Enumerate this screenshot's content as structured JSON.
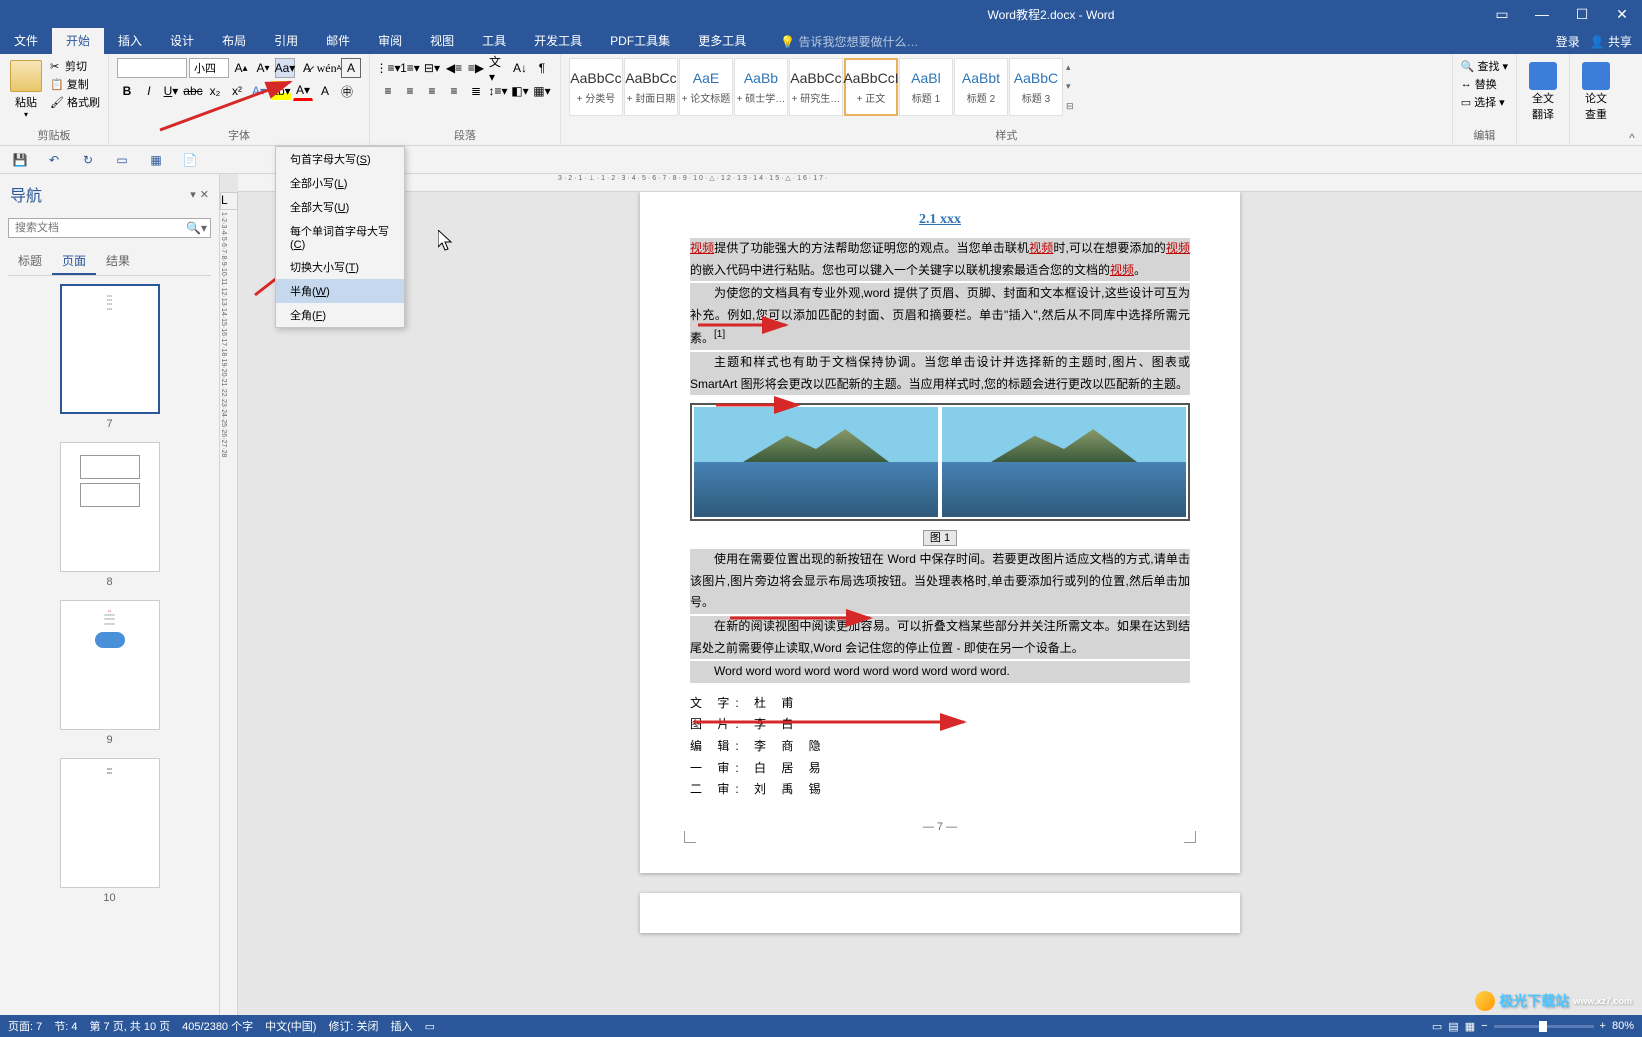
{
  "title": "Word教程2.docx - Word",
  "title_controls": {
    "login": "登录",
    "share": "共享"
  },
  "tabs": {
    "file": "文件",
    "home": "开始",
    "insert": "插入",
    "design": "设计",
    "layout": "布局",
    "references": "引用",
    "mailings": "邮件",
    "review": "审阅",
    "view": "视图",
    "tools": "工具",
    "developer": "开发工具",
    "pdf": "PDF工具集",
    "more": "更多工具",
    "tellme": "告诉我您想要做什么…"
  },
  "clipboard": {
    "paste": "粘贴",
    "cut": "剪切",
    "copy": "复制",
    "format_painter": "格式刷",
    "label": "剪贴板"
  },
  "font": {
    "name": "",
    "size": "小四",
    "label": "字体"
  },
  "paragraph": {
    "label": "段落"
  },
  "styles": {
    "label": "样式",
    "items": [
      {
        "preview": "AaBbCc",
        "name": "+ 分类号"
      },
      {
        "preview": "AaBbCc",
        "name": "+ 封面日期"
      },
      {
        "preview": "AaE",
        "name": "+ 论文标题"
      },
      {
        "preview": "AaBb",
        "name": "+ 硕士学…"
      },
      {
        "preview": "AaBbCc",
        "name": "+ 研究生…"
      },
      {
        "preview": "AaBbCcI",
        "name": "+ 正文"
      },
      {
        "preview": "AaBl",
        "name": "标题 1"
      },
      {
        "preview": "AaBbt",
        "name": "标题 2"
      },
      {
        "preview": "AaBbC",
        "name": "标题 3"
      }
    ],
    "selected": 5
  },
  "editing": {
    "find": "查找",
    "replace": "替换",
    "select": "选择",
    "label": "编辑"
  },
  "translate": {
    "label": "全文",
    "label2": "翻译"
  },
  "review": {
    "label": "论文",
    "label2": "查重"
  },
  "change_case_menu": [
    {
      "text": "句首字母大写",
      "key": "S"
    },
    {
      "text": "全部小写",
      "key": "L"
    },
    {
      "text": "全部大写",
      "key": "U"
    },
    {
      "text": "每个单词首字母大写",
      "key": "C"
    },
    {
      "text": "切换大小写",
      "key": "T"
    },
    {
      "text": "半角",
      "key": "W"
    },
    {
      "text": "全角",
      "key": "F"
    }
  ],
  "navigation": {
    "title": "导航",
    "search_placeholder": "搜索文档",
    "tabs": {
      "headings": "标题",
      "pages": "页面",
      "results": "结果"
    },
    "thumbs": [
      "7",
      "8",
      "9",
      "10"
    ],
    "selected_thumb": 0
  },
  "document": {
    "heading": "2.1 xxx",
    "keyword": "视频",
    "p1_a": "提供了功能强大的方法帮助您证明您的观点。当您单击联机",
    "p1_b": "时,可以在想要添加的",
    "p1_c": "的嵌入代码中进行粘贴。您也可以键入一个关键字以联机搜索最适合您的文档的",
    "p1_d": "。",
    "p2": "为使您的文档具有专业外观,word 提供了页眉、页脚、封面和文本框设计,这些设计可互为补充。例如,您可以添加匹配的封面、页眉和摘要栏。单击\"插入\",然后从不同库中选择所需元素。",
    "p2_sup": "[1]",
    "p3": "主题和样式也有助于文档保持协调。当您单击设计并选择新的主题时,图片、图表或 SmartArt 图形将会更改以匹配新的主题。当应用样式时,您的标题会进行更改以匹配新的主题。",
    "caption_prefix": "图",
    "caption_num": "1",
    "p4": "使用在需要位置出现的新按钮在 Word 中保存时间。若要更改图片适应文档的方式,请单击该图片,图片旁边将会显示布局选项按钮。当处理表格时,单击要添加行或列的位置,然后单击加号。",
    "p5": "在新的阅读视图中阅读更加容易。可以折叠文档某些部分并关注所需文本。如果在达到结尾处之前需要停止读取,Word 会记住您的停止位置 - 即使在另一个设备上。",
    "p6": "Word word word word word word word word word word.",
    "credits": [
      {
        "role": "文 字:",
        "name": "杜  甫"
      },
      {
        "role": "图 片:",
        "name": "李  白"
      },
      {
        "role": "编 辑:",
        "name": "李 商 隐"
      },
      {
        "role": "一 审:",
        "name": "白 居 易"
      },
      {
        "role": "二 审:",
        "name": "刘 禹 锡"
      }
    ],
    "page_num": "— 7 —"
  },
  "status": {
    "page": "页面: 7",
    "section": "节: 4",
    "page_of": "第 7 页, 共 10 页",
    "words": "405/2380 个字",
    "language": "中文(中国)",
    "revisions": "修订: 关闭",
    "insert": "插入",
    "zoom": "80%"
  },
  "watermark": "极光下载站"
}
